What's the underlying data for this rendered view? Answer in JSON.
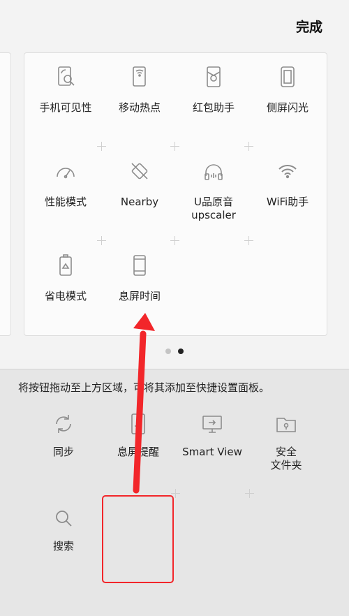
{
  "header": {
    "done_label": "完成"
  },
  "active_tiles": [
    {
      "icon": "device-visibility-icon",
      "label": "手机可见性"
    },
    {
      "icon": "mobile-hotspot-icon",
      "label": "移动热点"
    },
    {
      "icon": "red-envelope-icon",
      "label": "红包助手"
    },
    {
      "icon": "edge-lighting-icon",
      "label": "侧屏闪光"
    },
    {
      "icon": "performance-mode-icon",
      "label": "性能模式"
    },
    {
      "icon": "nearby-icon",
      "label": "Nearby"
    },
    {
      "icon": "headphones-icon",
      "label": "U品原音\nupscaler"
    },
    {
      "icon": "wifi-icon",
      "label": "WiFi助手"
    },
    {
      "icon": "power-saving-icon",
      "label": "省电模式"
    },
    {
      "icon": "screen-timeout-icon",
      "label": "息屏时间"
    }
  ],
  "pagination": {
    "pages": 2,
    "current": 2
  },
  "available": {
    "hint": "将按钮拖动至上方区域，可将其添加至快捷设置面板。",
    "tiles": [
      {
        "icon": "sync-icon",
        "label": "同步"
      },
      {
        "icon": "always-on-display-icon",
        "label": "息屏提醒"
      },
      {
        "icon": "smart-view-icon",
        "label": "Smart View"
      },
      {
        "icon": "secure-folder-icon",
        "label": "安全\n文件夹"
      },
      {
        "icon": "search-icon",
        "label": "搜索"
      }
    ]
  },
  "colors": {
    "annotation": "#f2262a",
    "icon": "#8c8c8c",
    "page_dot_active": "#222222",
    "page_dot_inactive": "#c4c4c4"
  }
}
